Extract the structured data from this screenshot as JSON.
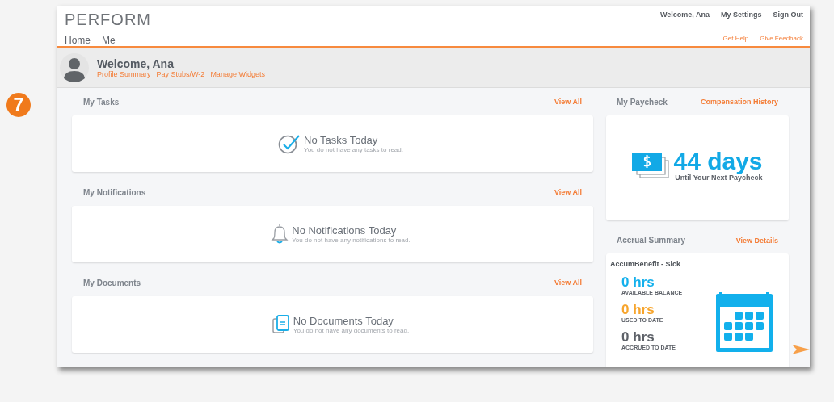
{
  "badge": "7",
  "header": {
    "logo": "PERFORM",
    "nav": [
      "Home",
      "Me"
    ],
    "user_links": [
      "Welcome, Ana",
      "My Settings",
      "Sign Out"
    ],
    "help_links": [
      "Get Help",
      "Give Feedback"
    ]
  },
  "profile": {
    "greeting": "Welcome, Ana",
    "links": [
      "Profile Summary",
      "Pay Stubs/W-2",
      "Manage Widgets"
    ]
  },
  "widgets": [
    {
      "kind": "tasks",
      "title": "My Tasks",
      "action": "View All",
      "empty_title": "No Tasks Today",
      "empty_text": "You do not have any tasks to read."
    },
    {
      "kind": "notifications",
      "title": "My Notifications",
      "action": "View All",
      "empty_title": "No Notifications Today",
      "empty_text": "You do not have any notifications to read."
    },
    {
      "kind": "documents",
      "title": "My Documents",
      "action": "View All",
      "empty_title": "No Documents Today",
      "empty_text": "You do not have any documents to read."
    }
  ],
  "paycheck": {
    "title": "My Paycheck",
    "action": "Compensation History",
    "days": "44 days",
    "caption": "Until Your Next Paycheck"
  },
  "accrual": {
    "title": "Accrual Summary",
    "action": "View Details",
    "benefit": "AccumBenefit - Sick",
    "stats": [
      {
        "value": "0 hrs",
        "label": "AVAILABLE BALANCE",
        "color": "#14b0ec"
      },
      {
        "value": "0 hrs",
        "label": "USED TO DATE",
        "color": "#f7a52d"
      },
      {
        "value": "0 hrs",
        "label": "ACCRUED TO DATE",
        "color": "#5d6168"
      }
    ]
  }
}
